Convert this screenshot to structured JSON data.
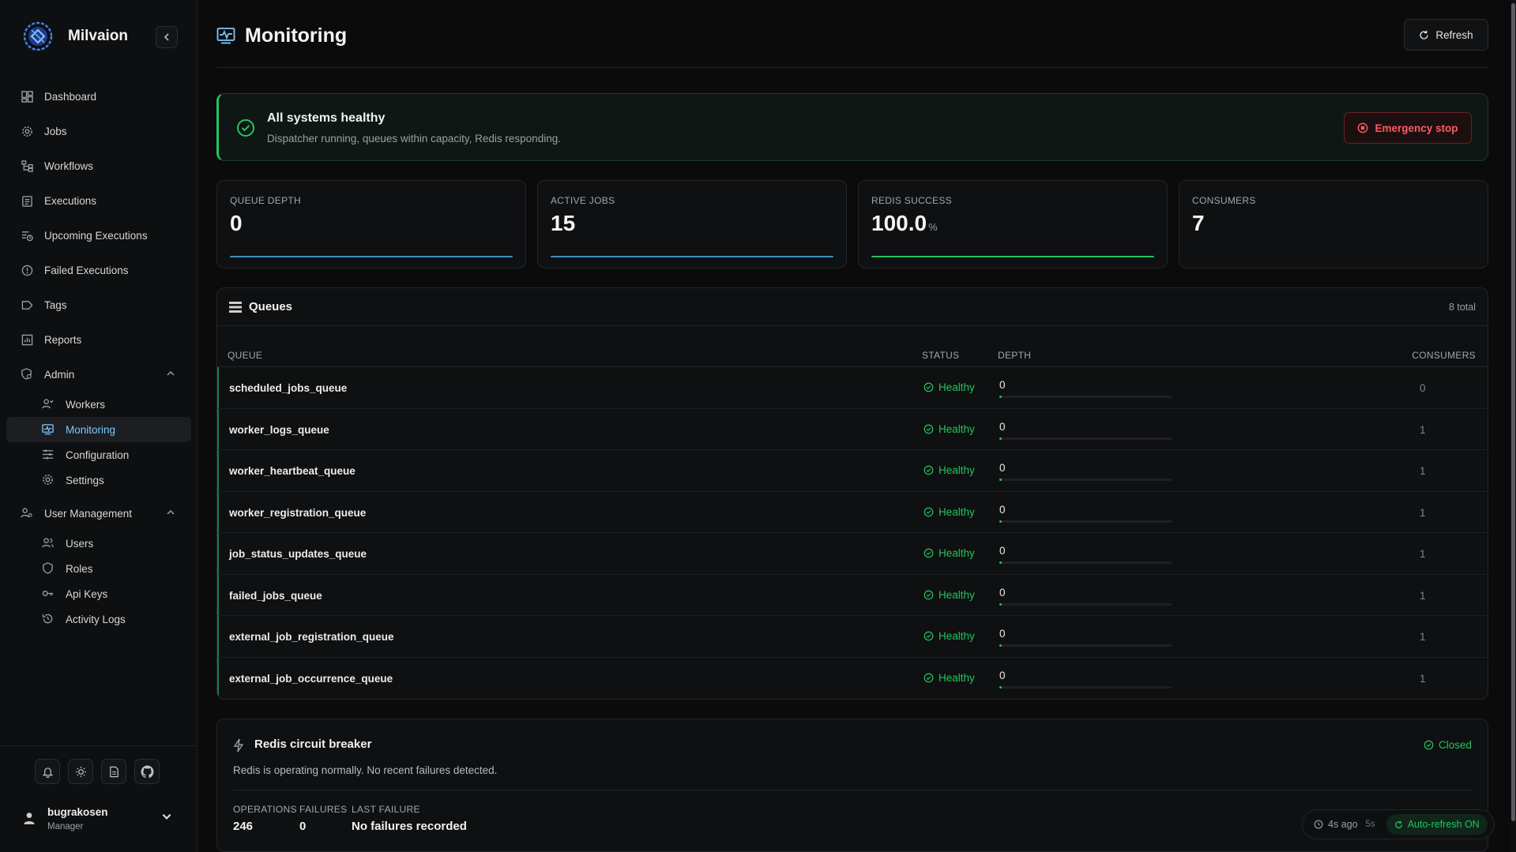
{
  "app": {
    "name": "Milvaion"
  },
  "sidebar": {
    "items": [
      {
        "label": "Dashboard",
        "icon": "dashboard-icon"
      },
      {
        "label": "Jobs",
        "icon": "gear-icon"
      },
      {
        "label": "Workflows",
        "icon": "workflow-icon"
      },
      {
        "label": "Executions",
        "icon": "clipboard-icon"
      },
      {
        "label": "Upcoming Executions",
        "icon": "calendar-clock-icon"
      },
      {
        "label": "Failed Executions",
        "icon": "alert-circle-icon"
      },
      {
        "label": "Tags",
        "icon": "tag-icon"
      },
      {
        "label": "Reports",
        "icon": "chart-icon"
      }
    ],
    "admin": {
      "label": "Admin",
      "items": [
        {
          "label": "Workers",
          "icon": "workers-icon"
        },
        {
          "label": "Monitoring",
          "icon": "monitor-icon"
        },
        {
          "label": "Configuration",
          "icon": "sliders-icon"
        },
        {
          "label": "Settings",
          "icon": "settings-icon"
        }
      ]
    },
    "user_management": {
      "label": "User Management",
      "items": [
        {
          "label": "Users",
          "icon": "users-icon"
        },
        {
          "label": "Roles",
          "icon": "shield-icon"
        },
        {
          "label": "Api Keys",
          "icon": "key-icon"
        },
        {
          "label": "Activity Logs",
          "icon": "history-icon"
        }
      ]
    },
    "footer_icons": [
      "bell-icon",
      "sun-icon",
      "document-icon",
      "github-icon"
    ],
    "user": {
      "name": "bugrakosen",
      "role": "Manager"
    }
  },
  "header": {
    "title": "Monitoring",
    "refresh_label": "Refresh"
  },
  "banner": {
    "title": "All systems healthy",
    "subtitle": "Dispatcher running, queues within capacity, Redis responding.",
    "emergency_label": "Emergency stop"
  },
  "stats": [
    {
      "label": "QUEUE DEPTH",
      "value": "0",
      "unit": "",
      "bar_color": "#3b8ec4"
    },
    {
      "label": "ACTIVE JOBS",
      "value": "15",
      "unit": "",
      "bar_color": "#3b8ec4"
    },
    {
      "label": "REDIS SUCCESS",
      "value": "100.0",
      "unit": "%",
      "bar_color": "#22c55e"
    },
    {
      "label": "CONSUMERS",
      "value": "7",
      "unit": ""
    }
  ],
  "queues": {
    "title": "Queues",
    "total": "8 total",
    "columns": {
      "queue": "QUEUE",
      "status": "STATUS",
      "depth": "DEPTH",
      "consumers": "CONSUMERS"
    },
    "rows": [
      {
        "name": "scheduled_jobs_queue",
        "status": "Healthy",
        "depth": "0",
        "consumers": "0"
      },
      {
        "name": "worker_logs_queue",
        "status": "Healthy",
        "depth": "0",
        "consumers": "1"
      },
      {
        "name": "worker_heartbeat_queue",
        "status": "Healthy",
        "depth": "0",
        "consumers": "1"
      },
      {
        "name": "worker_registration_queue",
        "status": "Healthy",
        "depth": "0",
        "consumers": "1"
      },
      {
        "name": "job_status_updates_queue",
        "status": "Healthy",
        "depth": "0",
        "consumers": "1"
      },
      {
        "name": "failed_jobs_queue",
        "status": "Healthy",
        "depth": "0",
        "consumers": "1"
      },
      {
        "name": "external_job_registration_queue",
        "status": "Healthy",
        "depth": "0",
        "consumers": "1"
      },
      {
        "name": "external_job_occurrence_queue",
        "status": "Healthy",
        "depth": "0",
        "consumers": "1"
      }
    ]
  },
  "circuit_breaker": {
    "title": "Redis circuit breaker",
    "state": "Closed",
    "description": "Redis is operating normally. No recent failures detected.",
    "metrics": [
      {
        "label": "OPERATIONS",
        "value": "246"
      },
      {
        "label": "FAILURES",
        "value": "0"
      },
      {
        "label": "LAST FAILURE",
        "value": "No failures recorded"
      }
    ]
  },
  "auto_refresh": {
    "ago": "4s ago",
    "interval": "5s",
    "label": "Auto-refresh ON"
  },
  "colors": {
    "accent": "#7ec8ff",
    "healthy": "#22c55e",
    "danger": "#ff5a5f"
  }
}
